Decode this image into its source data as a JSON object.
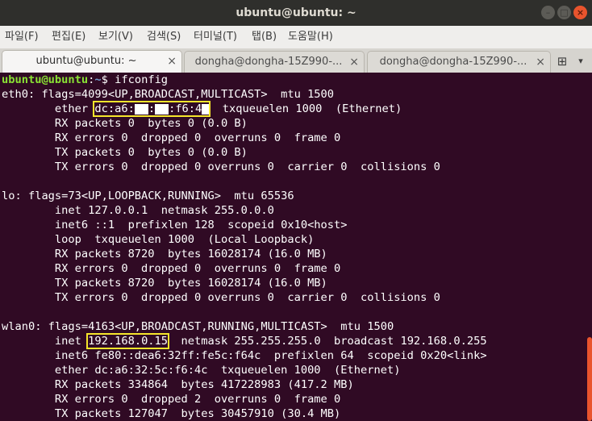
{
  "window": {
    "title": "ubuntu@ubuntu: ~",
    "minimize_glyph": "–",
    "maximize_glyph": "□",
    "close_glyph": "×"
  },
  "menu": [
    "파일(F)",
    "편집(E)",
    "보기(V)",
    "검색(S)",
    "터미널(T)",
    "탭(B)",
    "도움말(H)"
  ],
  "tabs": [
    {
      "label": "ubuntu@ubuntu: ~",
      "active": true
    },
    {
      "label": "dongha@dongha-15Z990-...",
      "active": false
    },
    {
      "label": "dongha@dongha-15Z990-...",
      "active": false
    }
  ],
  "tab_close_glyph": "×",
  "new_tab_glyph": "⊞",
  "tab_menu_glyph": "▾",
  "prompt": {
    "user": "ubuntu@ubuntu",
    "sep": ":",
    "path": "~",
    "symbol": "$ ",
    "command": "ifconfig"
  },
  "mac_parts": {
    "pre": "dc:a6:",
    "mid1": ":",
    "mid2": ":f6:4",
    "post": ""
  },
  "lines": {
    "eth0_head": "eth0: flags=4099<UP,BROADCAST,MULTICAST>  mtu 1500",
    "eth0_ether_prefix": "        ether ",
    "eth0_ether_suffix": "  txqueuelen 1000  (Ethernet)",
    "eth0_rx_packets": "        RX packets 0  bytes 0 (0.0 B)",
    "eth0_rx_errors": "        RX errors 0  dropped 0  overruns 0  frame 0",
    "eth0_tx_packets": "        TX packets 0  bytes 0 (0.0 B)",
    "eth0_tx_errors": "        TX errors 0  dropped 0 overruns 0  carrier 0  collisions 0",
    "lo_head": "lo: flags=73<UP,LOOPBACK,RUNNING>  mtu 65536",
    "lo_inet": "        inet 127.0.0.1  netmask 255.0.0.0",
    "lo_inet6": "        inet6 ::1  prefixlen 128  scopeid 0x10<host>",
    "lo_loop": "        loop  txqueuelen 1000  (Local Loopback)",
    "lo_rx_packets": "        RX packets 8720  bytes 16028174 (16.0 MB)",
    "lo_rx_errors": "        RX errors 0  dropped 0  overruns 0  frame 0",
    "lo_tx_packets": "        TX packets 8720  bytes 16028174 (16.0 MB)",
    "lo_tx_errors": "        TX errors 0  dropped 0 overruns 0  carrier 0  collisions 0",
    "wlan0_head": "wlan0: flags=4163<UP,BROADCAST,RUNNING,MULTICAST>  mtu 1500",
    "wlan0_inet_prefix": "        inet ",
    "wlan0_inet_ip": "192.168.0.15",
    "wlan0_inet_suffix": "  netmask 255.255.255.0  broadcast 192.168.0.255",
    "wlan0_inet6": "        inet6 fe80::dea6:32ff:fe5c:f64c  prefixlen 64  scopeid 0x20<link>",
    "wlan0_ether": "        ether dc:a6:32:5c:f6:4c  txqueuelen 1000  (Ethernet)",
    "wlan0_rx_packets": "        RX packets 334864  bytes 417228983 (417.2 MB)",
    "wlan0_rx_errors": "        RX errors 0  dropped 2  overruns 0  frame 0",
    "wlan0_tx_packets": "        TX packets 127047  bytes 30457910 (30.4 MB)"
  },
  "colors": {
    "terminal_bg": "#300a24",
    "prompt_user": "#8ae234",
    "prompt_path": "#729fcf",
    "highlight_box": "#f5e52b",
    "close_button": "#e9542d"
  }
}
